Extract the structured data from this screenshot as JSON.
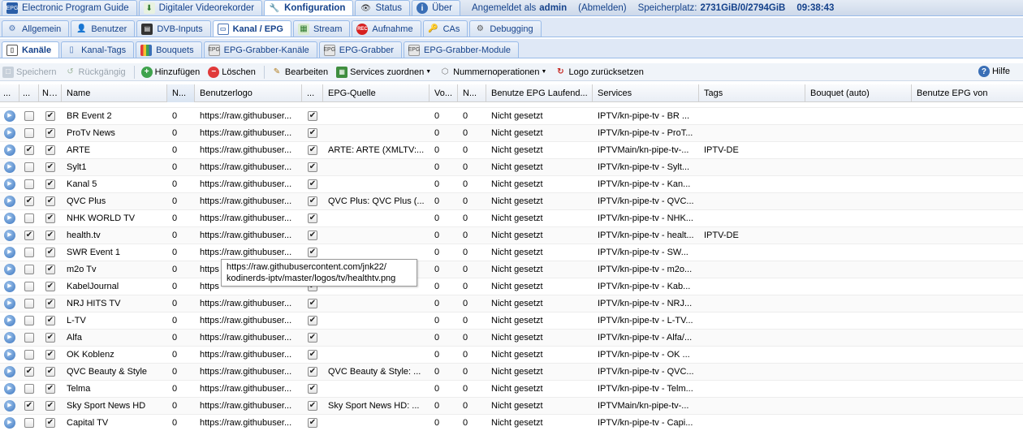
{
  "top_tabs": [
    {
      "label": "Electronic Program Guide",
      "icon": "epg-icon",
      "active": false
    },
    {
      "label": "Digitaler Videorekorder",
      "icon": "recorder-icon",
      "active": false
    },
    {
      "label": "Konfiguration",
      "icon": "wrench-icon",
      "active": true
    },
    {
      "label": "Status",
      "icon": "eye-icon",
      "active": false
    },
    {
      "label": "Über",
      "icon": "info-icon",
      "active": false
    }
  ],
  "status": {
    "logged_in_prefix": "Angemeldet als",
    "user": "admin",
    "logout": "(Abmelden)",
    "storage_label": "Speicherplatz:",
    "storage_value": "2731GiB/0/2794GiB",
    "time": "09:38:43"
  },
  "config_tabs": [
    {
      "label": "Allgemein",
      "icon": "gear-icon",
      "active": false
    },
    {
      "label": "Benutzer",
      "icon": "user-icon",
      "active": false
    },
    {
      "label": "DVB-Inputs",
      "icon": "dvb-icon",
      "active": false
    },
    {
      "label": "Kanal / EPG",
      "icon": "tv-icon",
      "active": true
    },
    {
      "label": "Stream",
      "icon": "stream-icon",
      "active": false
    },
    {
      "label": "Aufnahme",
      "icon": "rec-icon",
      "active": false
    },
    {
      "label": "CAs",
      "icon": "key-icon",
      "active": false
    },
    {
      "label": "Debugging",
      "icon": "debug-icon",
      "active": false
    }
  ],
  "sub_tabs": [
    {
      "label": "Kanäle",
      "icon": "phone-icon",
      "active": true
    },
    {
      "label": "Kanal-Tags",
      "icon": "tag-icon",
      "active": false
    },
    {
      "label": "Bouquets",
      "icon": "bouquet-icon",
      "active": false
    },
    {
      "label": "EPG-Grabber-Kanäle",
      "icon": "grabber-icon",
      "active": false
    },
    {
      "label": "EPG-Grabber",
      "icon": "grabber-icon",
      "active": false
    },
    {
      "label": "EPG-Grabber-Module",
      "icon": "grabber-icon",
      "active": false
    }
  ],
  "toolbar": {
    "save": "Speichern",
    "undo": "Rückgängig",
    "add": "Hinzufügen",
    "delete": "Löschen",
    "edit": "Bearbeiten",
    "map_services": "Services zuordnen",
    "number_ops": "Nummernoperationen",
    "reset_logo": "Logo zurücksetzen",
    "help": "Hilfe"
  },
  "columns": [
    "...",
    "...",
    "Name",
    "N...",
    "Benutzerlogo",
    "...",
    "EPG-Quelle",
    "Vo...",
    "N...",
    "Benutze EPG Laufend...",
    "Services",
    "Tags",
    "Bouquet (auto)",
    "Benutze EPG von"
  ],
  "rows": [
    {
      "enabled": false,
      "autoname": true,
      "name": "BR Event 2",
      "number": "0",
      "logo": "https://raw.githubuser...",
      "epgauto": true,
      "epg": "",
      "vo": "0",
      "n": "0",
      "running": "Nicht gesetzt",
      "services": "IPTV/kn-pipe-tv - BR ...",
      "tags": ""
    },
    {
      "enabled": false,
      "autoname": true,
      "name": "ProTv News",
      "number": "0",
      "logo": "https://raw.githubuser...",
      "epgauto": true,
      "epg": "",
      "vo": "0",
      "n": "0",
      "running": "Nicht gesetzt",
      "services": "IPTV/kn-pipe-tv - ProT...",
      "tags": ""
    },
    {
      "enabled": true,
      "autoname": true,
      "name": "ARTE",
      "number": "0",
      "logo": "https://raw.githubuser...",
      "epgauto": true,
      "epg": "ARTE: ARTE (XMLTV:...",
      "vo": "0",
      "n": "0",
      "running": "Nicht gesetzt",
      "services": "IPTVMain/kn-pipe-tv-...",
      "tags": "IPTV-DE"
    },
    {
      "enabled": false,
      "autoname": true,
      "name": "Sylt1",
      "number": "0",
      "logo": "https://raw.githubuser...",
      "epgauto": true,
      "epg": "",
      "vo": "0",
      "n": "0",
      "running": "Nicht gesetzt",
      "services": "IPTV/kn-pipe-tv - Sylt...",
      "tags": ""
    },
    {
      "enabled": false,
      "autoname": true,
      "name": "Kanal 5",
      "number": "0",
      "logo": "https://raw.githubuser...",
      "epgauto": true,
      "epg": "",
      "vo": "0",
      "n": "0",
      "running": "Nicht gesetzt",
      "services": "IPTV/kn-pipe-tv - Kan...",
      "tags": ""
    },
    {
      "enabled": true,
      "autoname": true,
      "name": "QVC Plus",
      "number": "0",
      "logo": "https://raw.githubuser...",
      "epgauto": true,
      "epg": "QVC Plus: QVC Plus (...",
      "vo": "0",
      "n": "0",
      "running": "Nicht gesetzt",
      "services": "IPTV/kn-pipe-tv - QVC...",
      "tags": ""
    },
    {
      "enabled": false,
      "autoname": true,
      "name": "NHK WORLD TV",
      "number": "0",
      "logo": "https://raw.githubuser...",
      "epgauto": true,
      "epg": "",
      "vo": "0",
      "n": "0",
      "running": "Nicht gesetzt",
      "services": "IPTV/kn-pipe-tv - NHK...",
      "tags": ""
    },
    {
      "enabled": true,
      "autoname": true,
      "name": "health.tv",
      "number": "0",
      "logo": "https://raw.githubuser...",
      "epgauto": true,
      "epg": "",
      "vo": "0",
      "n": "0",
      "running": "Nicht gesetzt",
      "services": "IPTV/kn-pipe-tv - healt...",
      "tags": "IPTV-DE"
    },
    {
      "enabled": false,
      "autoname": true,
      "name": "SWR Event 1",
      "number": "0",
      "logo": "https://raw.githubuser...",
      "epgauto": true,
      "epg": "",
      "vo": "0",
      "n": "0",
      "running": "Nicht gesetzt",
      "services": "IPTV/kn-pipe-tv - SW...",
      "tags": ""
    },
    {
      "enabled": false,
      "autoname": true,
      "name": "m2o Tv",
      "number": "0",
      "logo": "https",
      "epgauto": true,
      "epg": "",
      "vo": "0",
      "n": "0",
      "running": "Nicht gesetzt",
      "services": "IPTV/kn-pipe-tv - m2o...",
      "tags": ""
    },
    {
      "enabled": false,
      "autoname": true,
      "name": "KabelJournal",
      "number": "0",
      "logo": "https",
      "epgauto": true,
      "epg": "",
      "vo": "0",
      "n": "0",
      "running": "Nicht gesetzt",
      "services": "IPTV/kn-pipe-tv - Kab...",
      "tags": ""
    },
    {
      "enabled": false,
      "autoname": true,
      "name": "NRJ HITS TV",
      "number": "0",
      "logo": "https://raw.githubuser...",
      "epgauto": true,
      "epg": "",
      "vo": "0",
      "n": "0",
      "running": "Nicht gesetzt",
      "services": "IPTV/kn-pipe-tv - NRJ...",
      "tags": ""
    },
    {
      "enabled": false,
      "autoname": true,
      "name": "L-TV",
      "number": "0",
      "logo": "https://raw.githubuser...",
      "epgauto": true,
      "epg": "",
      "vo": "0",
      "n": "0",
      "running": "Nicht gesetzt",
      "services": "IPTV/kn-pipe-tv - L-TV...",
      "tags": ""
    },
    {
      "enabled": false,
      "autoname": true,
      "name": "Alfa",
      "number": "0",
      "logo": "https://raw.githubuser...",
      "epgauto": true,
      "epg": "",
      "vo": "0",
      "n": "0",
      "running": "Nicht gesetzt",
      "services": "IPTV/kn-pipe-tv - Alfa/...",
      "tags": ""
    },
    {
      "enabled": false,
      "autoname": true,
      "name": "OK Koblenz",
      "number": "0",
      "logo": "https://raw.githubuser...",
      "epgauto": true,
      "epg": "",
      "vo": "0",
      "n": "0",
      "running": "Nicht gesetzt",
      "services": "IPTV/kn-pipe-tv - OK ...",
      "tags": ""
    },
    {
      "enabled": true,
      "autoname": true,
      "name": "QVC Beauty & Style",
      "number": "0",
      "logo": "https://raw.githubuser...",
      "epgauto": true,
      "epg": "QVC Beauty & Style: ...",
      "vo": "0",
      "n": "0",
      "running": "Nicht gesetzt",
      "services": "IPTV/kn-pipe-tv - QVC...",
      "tags": ""
    },
    {
      "enabled": false,
      "autoname": true,
      "name": "Telma",
      "number": "0",
      "logo": "https://raw.githubuser...",
      "epgauto": true,
      "epg": "",
      "vo": "0",
      "n": "0",
      "running": "Nicht gesetzt",
      "services": "IPTV/kn-pipe-tv - Telm...",
      "tags": ""
    },
    {
      "enabled": true,
      "autoname": true,
      "name": "Sky Sport News HD",
      "number": "0",
      "logo": "https://raw.githubuser...",
      "epgauto": true,
      "epg": "Sky Sport News HD: ...",
      "vo": "0",
      "n": "0",
      "running": "Nicht gesetzt",
      "services": "IPTVMain/kn-pipe-tv-...",
      "tags": ""
    },
    {
      "enabled": false,
      "autoname": true,
      "name": "Capital TV",
      "number": "0",
      "logo": "https://raw.githubuser...",
      "epgauto": true,
      "epg": "",
      "vo": "0",
      "n": "0",
      "running": "Nicht gesetzt",
      "services": "IPTV/kn-pipe-tv - Capi...",
      "tags": ""
    }
  ],
  "tooltip": {
    "line1": "https://raw.githubusercontent.com/jnk22/",
    "line2": "kodinerds-iptv/master/logos/tv/healthtv.png"
  },
  "colors": {
    "accent": "#15428b",
    "tab_border": "#99bbe8",
    "tab_bg": "#dfe8f6"
  }
}
